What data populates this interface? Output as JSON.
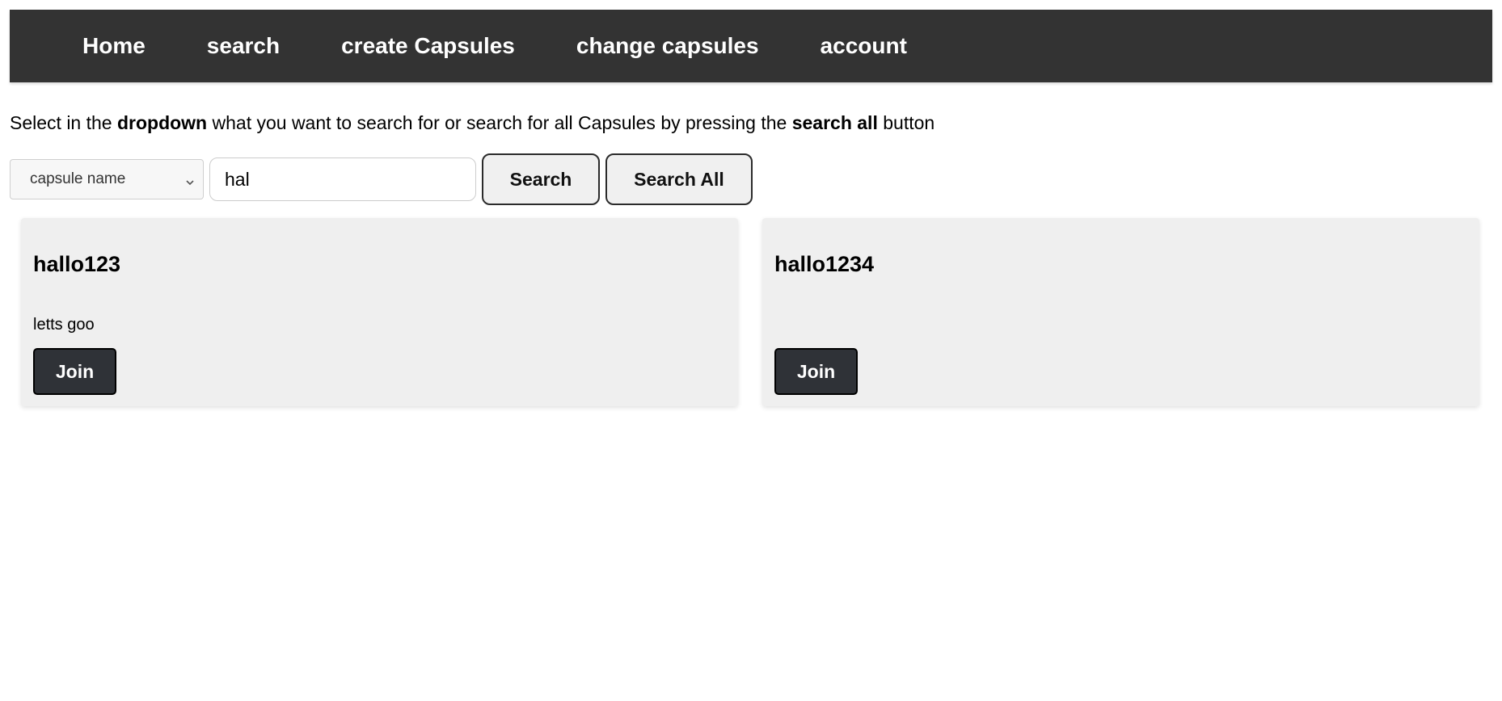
{
  "nav": {
    "items": [
      {
        "label": "Home"
      },
      {
        "label": "search"
      },
      {
        "label": "create Capsules"
      },
      {
        "label": "change capsules"
      },
      {
        "label": "account"
      }
    ]
  },
  "intro": {
    "part1": "Select in the ",
    "bold1": "dropdown",
    "part2": " what you want to search for or search for all Capsules by pressing the ",
    "bold2": "search all",
    "part3": " button"
  },
  "search": {
    "dropdown_selected": "capsule name",
    "query_value": "hal",
    "search_label": "Search",
    "search_all_label": "Search All"
  },
  "results": [
    {
      "title": "hallo123",
      "description": "letts goo",
      "join_label": "Join"
    },
    {
      "title": "hallo1234",
      "description": "",
      "join_label": "Join"
    }
  ],
  "colors": {
    "navbar_bg": "#333333",
    "card_bg": "#efefef",
    "join_bg": "#2f3237"
  }
}
